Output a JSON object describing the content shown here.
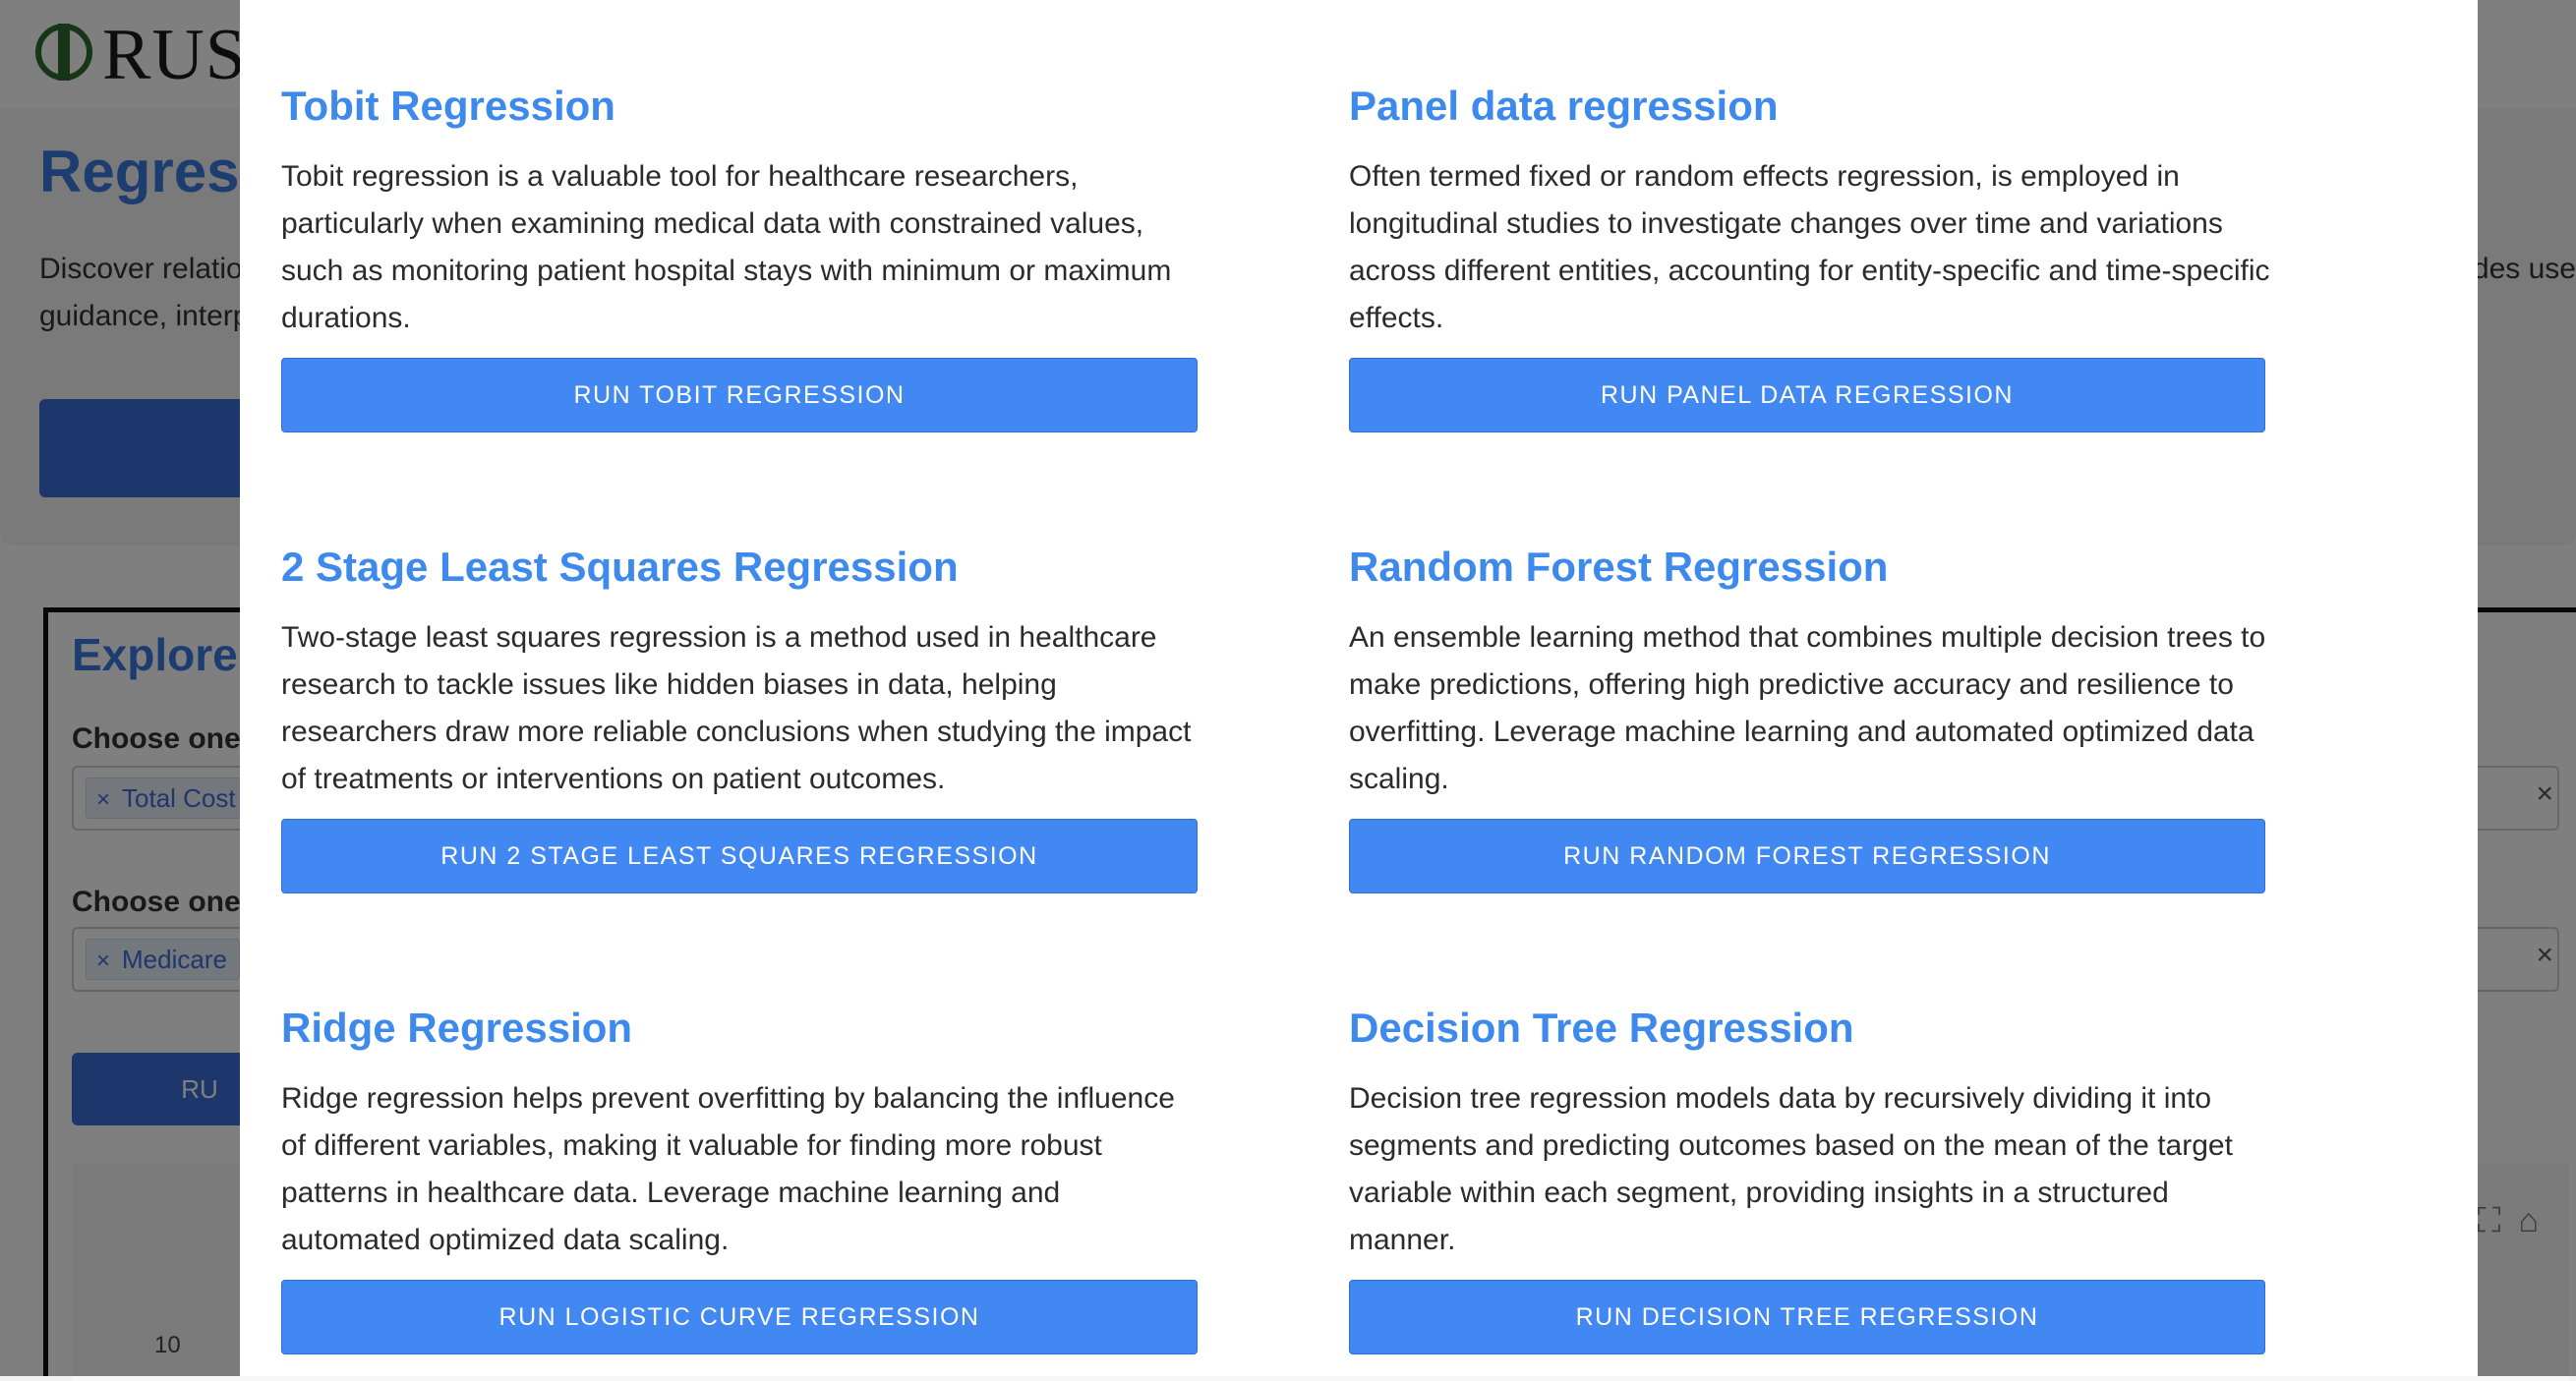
{
  "background": {
    "logo_text": "RUS",
    "intro": {
      "title": "Regress",
      "text_left": "Discover relatio\nguidance, interp",
      "text_right": "des use"
    },
    "explore": {
      "title": "Explore r",
      "label_outcome": "Choose one",
      "outcome_tag": "Total Cost",
      "label_predictor": "Choose one",
      "predictor_tag": "Medicare",
      "run_button_label": "RU",
      "axis_tick": "10"
    }
  },
  "modal": {
    "cards": [
      {
        "title": "Tobit Regression",
        "description": "Tobit regression is a valuable tool for healthcare researchers, particularly when examining medical data with constrained values, such as monitoring patient hospital stays with minimum or maximum durations.",
        "button": "Run Tobit Regression"
      },
      {
        "title": "Panel data regression",
        "description": "Often termed fixed or random effects regression, is employed in longitudinal studies to investigate changes over time and variations across different entities, accounting for entity-specific and time-specific effects.",
        "button": "Run Panel Data Regression"
      },
      {
        "title": "2 Stage Least Squares Regression",
        "description": "Two-stage least squares regression is a method used in healthcare research to tackle issues like hidden biases in data, helping researchers draw more reliable conclusions when studying the impact of treatments or interventions on patient outcomes.",
        "button": "Run 2 Stage Least Squares Regression"
      },
      {
        "title": "Random Forest Regression",
        "description": "An ensemble learning method that combines multiple decision trees to make predictions, offering high predictive accuracy and resilience to overfitting. Leverage machine learning and automated optimized data scaling.",
        "button": "Run Random Forest Regression"
      },
      {
        "title": "Ridge Regression",
        "description": "Ridge regression helps prevent overfitting by balancing the influence of different variables, making it valuable for finding more robust patterns in healthcare data. Leverage machine learning and automated optimized data scaling.",
        "button": "Run Logistic Curve Regression"
      },
      {
        "title": "Decision Tree Regression",
        "description": "Decision tree regression models data by recursively dividing it into segments and predicting outcomes based on the mean of the target variable within each segment, providing insights in a structured manner.",
        "button": "Run Decision Tree Regression"
      }
    ]
  }
}
